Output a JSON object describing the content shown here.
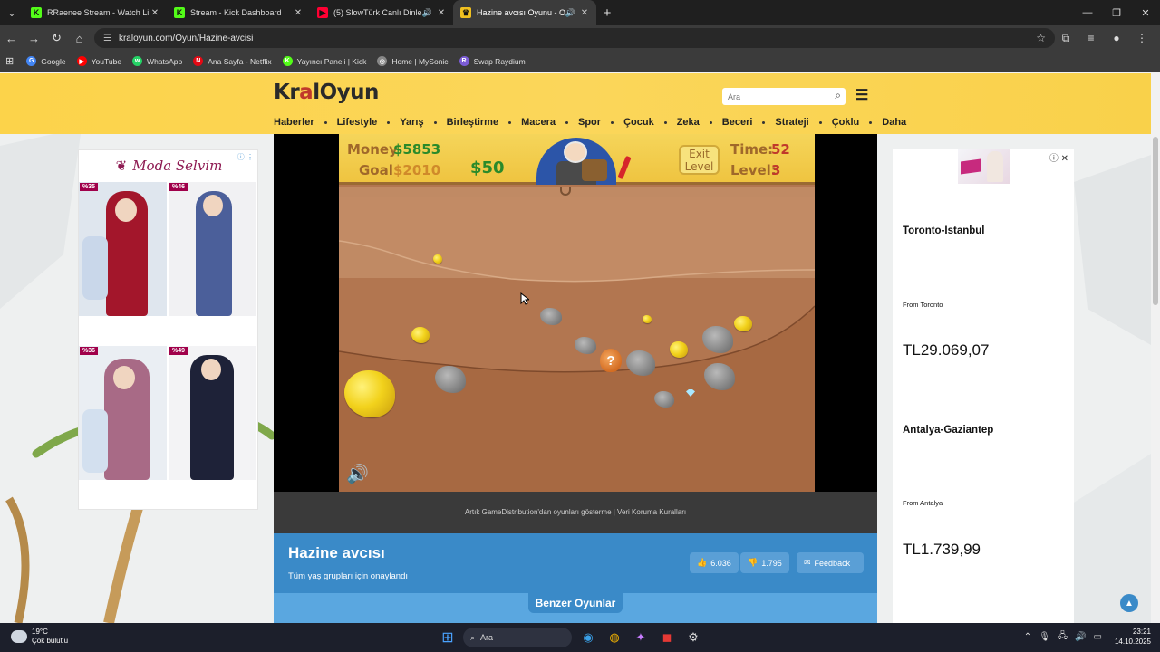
{
  "browser": {
    "tabs": [
      {
        "title": "RRaenee Stream - Watch Live o",
        "fav_color": "#53fc18",
        "fav": "K",
        "active": false
      },
      {
        "title": "Stream - Kick Dashboard",
        "fav_color": "#53fc18",
        "fav": "K",
        "active": false
      },
      {
        "title": "(5) SlowTürk Canlı Dinle",
        "fav_color": "#ff0033",
        "fav": "▶",
        "active": false
      },
      {
        "title": "Hazine avcısı Oyunu - Onli",
        "fav_color": "#f0c020",
        "fav": "♛",
        "active": true
      }
    ],
    "url": "kraloyun.com/Oyun/Hazine-avcisi",
    "bookmarks": [
      {
        "label": "Google",
        "color": "#4285f4",
        "icon": "G"
      },
      {
        "label": "YouTube",
        "color": "#ff0000",
        "icon": "▶"
      },
      {
        "label": "WhatsApp",
        "color": "#25d366",
        "icon": "w"
      },
      {
        "label": "Ana Sayfa - Netflix",
        "color": "#e50914",
        "icon": "N"
      },
      {
        "label": "Yayıncı Paneli | Kick",
        "color": "#53fc18",
        "icon": "K"
      },
      {
        "label": "Home | MySonic",
        "color": "#888888",
        "icon": "◎"
      },
      {
        "label": "Swap Raydium",
        "color": "#7b5cd6",
        "icon": "R"
      }
    ]
  },
  "site": {
    "logo_pre": "Kr",
    "logo_crown": "a",
    "logo_post": "lOyun",
    "search_placeholder": "Ara",
    "nav": [
      "Haberler",
      "Lifestyle",
      "Yarış",
      "Birleştirme",
      "Macera",
      "Spor",
      "Çocuk",
      "Zeka",
      "Beceri",
      "Strateji",
      "Çoklu",
      "Daha"
    ]
  },
  "ad_left": {
    "brand": "Moda Selvim",
    "badges": [
      "%35",
      "%46",
      "%36",
      "%49"
    ]
  },
  "ad_right": {
    "routes": [
      {
        "route": "Toronto-Istanbul",
        "from": "From Toronto",
        "price": "TL29.069,07"
      },
      {
        "route": "Antalya-Gaziantep",
        "from": "From Antalya",
        "price": "TL1.739,99"
      }
    ]
  },
  "game": {
    "money_label": "Money",
    "money_value": "$5853",
    "goal_label": "Goal",
    "goal_value": "$2010",
    "bonus": "$50",
    "exit_line1": "Exit",
    "exit_line2": "Level",
    "time_label": "Time:",
    "time_value": "52",
    "level_label": "Level:",
    "level_value": "3",
    "bag_symbol": "?"
  },
  "gd_notice": "Artık GameDistribution'dan oyunları gösterme | Veri Koruma Kuralları",
  "info": {
    "title": "Hazine avcısı",
    "age_note": "Tüm yaş grupları için onaylandı",
    "likes": "6.036",
    "dislikes": "1.795",
    "feedback": "Feedback"
  },
  "similar_label": "Benzer Oyunlar",
  "taskbar": {
    "temp": "19°C",
    "weather": "Çok bulutlu",
    "search": "Ara",
    "time": "23:21",
    "date": "14.10.2025"
  }
}
